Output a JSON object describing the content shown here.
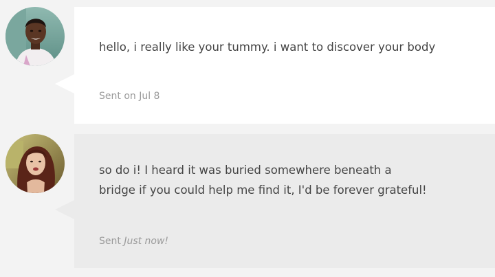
{
  "messages": [
    {
      "text": "hello, i really like your tummy. i want to discover your body",
      "sent_prefix": "Sent on ",
      "sent_time": "Jul 8"
    },
    {
      "text_lines": [
        "so do i! I heard it was buried somewhere beneath a",
        "bridge if you could help me find it, I'd be forever grateful!"
      ],
      "sent_prefix": "Sent ",
      "sent_time": "Just now!"
    }
  ],
  "colors": {
    "page_background": "#f3f3f3",
    "bubble_incoming": "#ffffff",
    "bubble_outgoing": "#ebebeb",
    "message_text": "#444444",
    "meta_text": "#9a9a9a"
  },
  "icons": {
    "sender_avatar": "avatar-photo-man",
    "reply_avatar": "avatar-photo-woman"
  }
}
